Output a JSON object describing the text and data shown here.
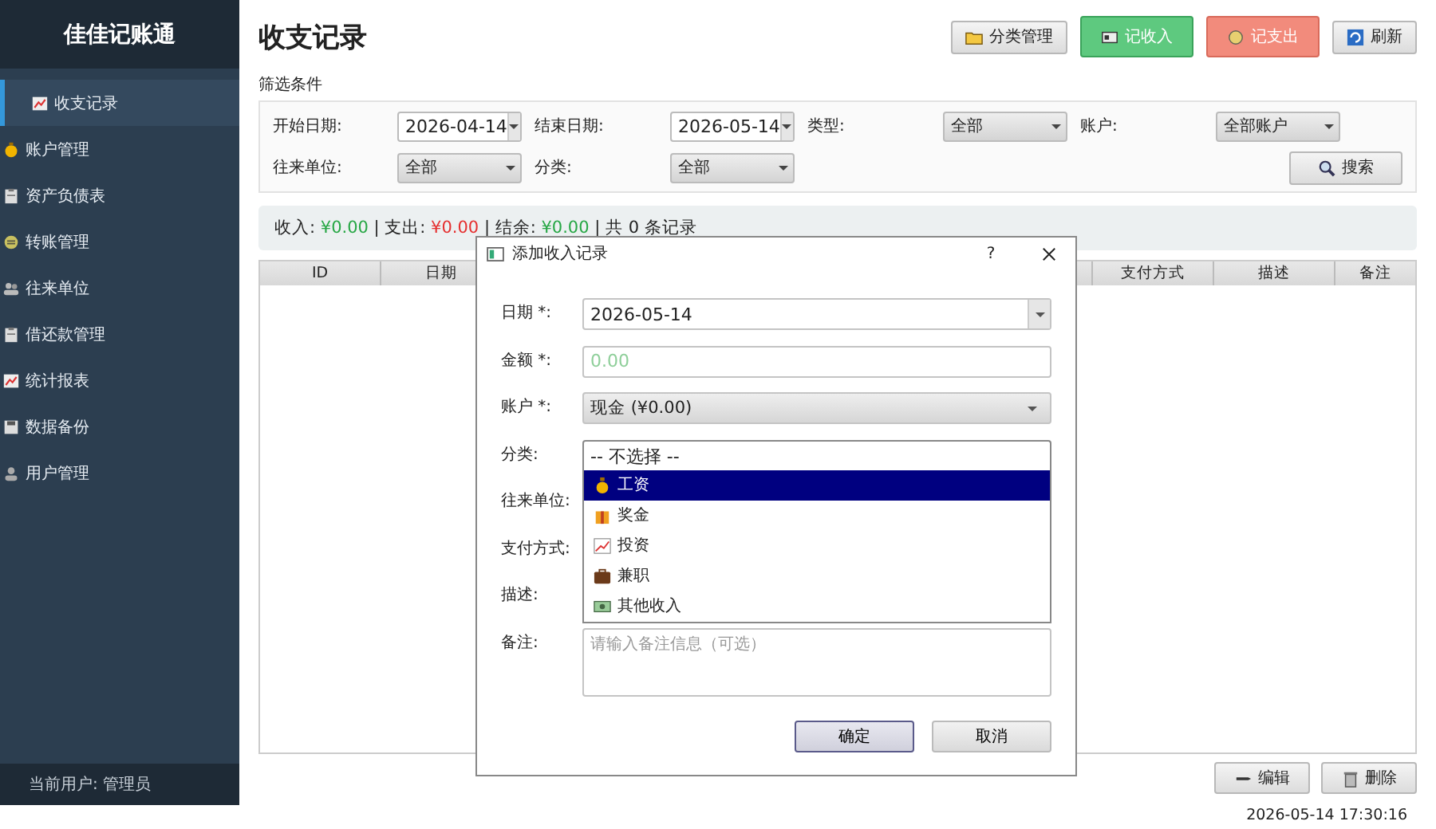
{
  "app": {
    "title": "佳佳记账通",
    "nav": [
      {
        "label": "收支记录",
        "selected": true
      },
      {
        "label": "账户管理",
        "selected": false
      },
      {
        "label": "资产负债表",
        "selected": false
      },
      {
        "label": "转账管理",
        "selected": false
      },
      {
        "label": "往来单位",
        "selected": false
      },
      {
        "label": "借还款管理",
        "selected": false
      },
      {
        "label": "统计报表",
        "selected": false
      },
      {
        "label": "数据备份",
        "selected": false
      },
      {
        "label": "用户管理",
        "selected": false
      }
    ],
    "current_user": "当前用户: 管理员"
  },
  "page": {
    "title": "收支记录",
    "toolbar": [
      {
        "label": "分类管理",
        "kind": "plain"
      },
      {
        "label": "记收入",
        "kind": "income"
      },
      {
        "label": "记支出",
        "kind": "expense"
      },
      {
        "label": "刷新",
        "kind": "plain"
      }
    ]
  },
  "filters": {
    "title": "筛选条件",
    "rows": [
      [
        {
          "label": "开始日期:",
          "value": "2026-04-14",
          "kind": "date"
        },
        {
          "label": "结束日期:",
          "value": "2026-05-14",
          "kind": "date"
        },
        {
          "label": "类型:",
          "value": "全部",
          "kind": "combo"
        },
        {
          "label": "账户:",
          "value": "全部账户",
          "kind": "combo"
        }
      ],
      [
        {
          "label": "往来单位:",
          "value": "全部",
          "kind": "combo"
        },
        {
          "label": "分类:",
          "value": "全部",
          "kind": "combo"
        }
      ]
    ],
    "search_button": "搜索"
  },
  "summary": [
    {
      "text": "收入: ",
      "kind": "plain"
    },
    {
      "text": "¥0.00",
      "kind": "positive"
    },
    {
      "text": " | 支出: ",
      "kind": "plain"
    },
    {
      "text": "¥0.00",
      "kind": "negative"
    },
    {
      "text": " | 结余: ",
      "kind": "plain"
    },
    {
      "text": "¥0.00",
      "kind": "positive"
    },
    {
      "text": " | 共 0 条记录",
      "kind": "plain"
    }
  ],
  "table": {
    "columns_left": [
      "ID",
      "日期"
    ],
    "columns_right": [
      "支付方式",
      "描述",
      "备注"
    ]
  },
  "actions": [
    {
      "label": "编辑",
      "kind": "edit"
    },
    {
      "label": "删除",
      "kind": "delete"
    }
  ],
  "status_time": "2026-05-14 17:30:16",
  "dialog": {
    "title": "添加收入记录",
    "help": "?",
    "fields": [
      {
        "label": "日期 *:",
        "kind": "date",
        "value": "2026-05-14"
      },
      {
        "label": "金额 *:",
        "kind": "input",
        "placeholder": "0.00"
      },
      {
        "label": "账户 *:",
        "kind": "combo",
        "value": "现金 (¥0.00)"
      },
      {
        "label": "分类:",
        "kind": "list",
        "value": "-- 不选择 --",
        "options": [
          {
            "label": "工资",
            "selected": true
          },
          {
            "label": "奖金",
            "selected": false
          },
          {
            "label": "投资",
            "selected": false
          },
          {
            "label": "兼职",
            "selected": false
          },
          {
            "label": "其他收入",
            "selected": false
          }
        ]
      },
      {
        "label": "往来单位:",
        "kind": "covered"
      },
      {
        "label": "支付方式:",
        "kind": "covered"
      },
      {
        "label": "描述:",
        "kind": "covered"
      },
      {
        "label": "备注:",
        "kind": "textarea",
        "placeholder": "请输入备注信息（可选）"
      }
    ],
    "buttons": [
      {
        "label": "确定",
        "kind": "default"
      },
      {
        "label": "取消",
        "kind": "plain"
      }
    ]
  }
}
